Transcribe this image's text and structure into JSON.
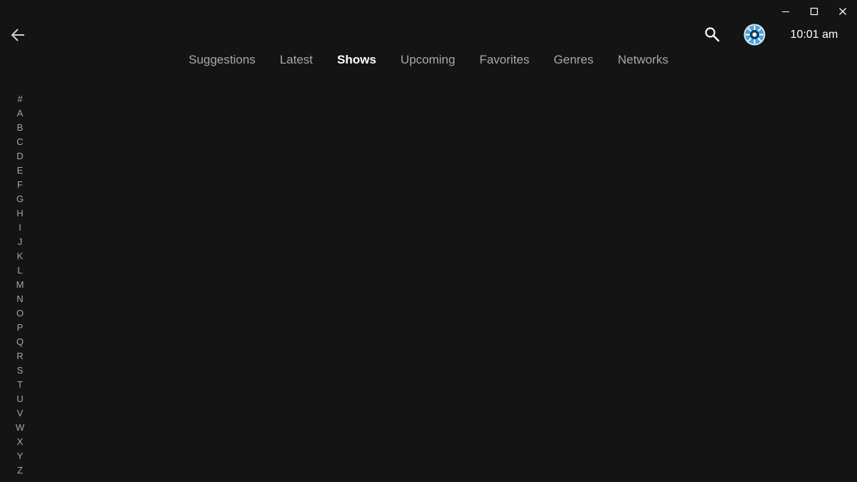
{
  "window": {
    "controls": [
      "minimize-icon",
      "maximize-icon",
      "close-icon"
    ]
  },
  "header": {
    "back_icon": "arrow-left-icon",
    "search_icon": "search-icon",
    "avatar_icon": "avatar-icon",
    "time": "10:01 am",
    "accent_color": "#4aa3df"
  },
  "tabs": [
    {
      "label": "Suggestions",
      "active": false
    },
    {
      "label": "Latest",
      "active": false
    },
    {
      "label": "Shows",
      "active": true
    },
    {
      "label": "Upcoming",
      "active": false
    },
    {
      "label": "Favorites",
      "active": false
    },
    {
      "label": "Genres",
      "active": false
    },
    {
      "label": "Networks",
      "active": false
    }
  ],
  "alphabet": [
    "#",
    "A",
    "B",
    "C",
    "D",
    "E",
    "F",
    "G",
    "H",
    "I",
    "J",
    "K",
    "L",
    "M",
    "N",
    "O",
    "P",
    "Q",
    "R",
    "S",
    "T",
    "U",
    "V",
    "W",
    "X",
    "Y",
    "Z"
  ]
}
